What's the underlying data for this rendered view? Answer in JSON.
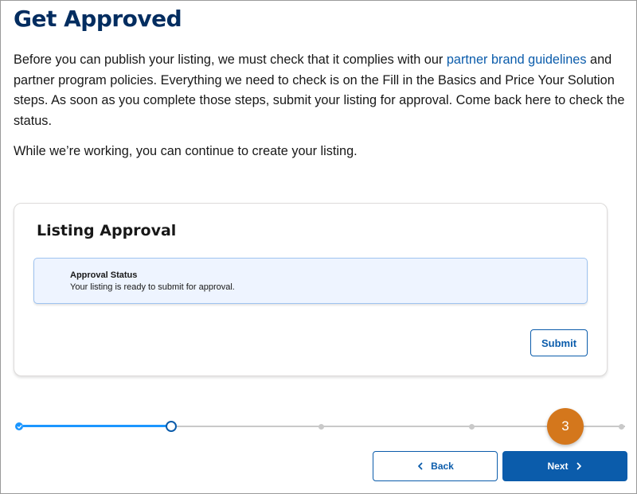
{
  "page": {
    "title": "Get Approved",
    "intro_before_link": "Before you can publish your listing, we must check that it complies with our ",
    "intro_link": "partner brand guidelines",
    "intro_after_link": " and partner program policies. Everything we need to check is on the Fill in the Basics and Price Your Solution steps. As soon as you complete those steps, submit your listing for approval. Come back here to check the status.",
    "working_text": "While we’re working, you can continue to create your listing."
  },
  "card": {
    "title": "Listing Approval",
    "status_title": "Approval Status",
    "status_text": "Your listing is ready to submit for approval.",
    "submit_label": "Submit"
  },
  "progress": {
    "total_steps": 5,
    "current_step": 2,
    "completed_steps": 1
  },
  "annotation": {
    "badge_number": "3"
  },
  "nav": {
    "back_label": "Back",
    "next_label": "Next"
  },
  "icons": {
    "check": "check-icon",
    "chevron_left": "chevron-left-icon",
    "chevron_right": "chevron-right-icon"
  },
  "colors": {
    "brand_blue": "#0b5cab",
    "progress_blue": "#1b96ff",
    "title_navy": "#032d60",
    "badge_orange": "#d4771c",
    "status_bg": "#eef4ff"
  }
}
